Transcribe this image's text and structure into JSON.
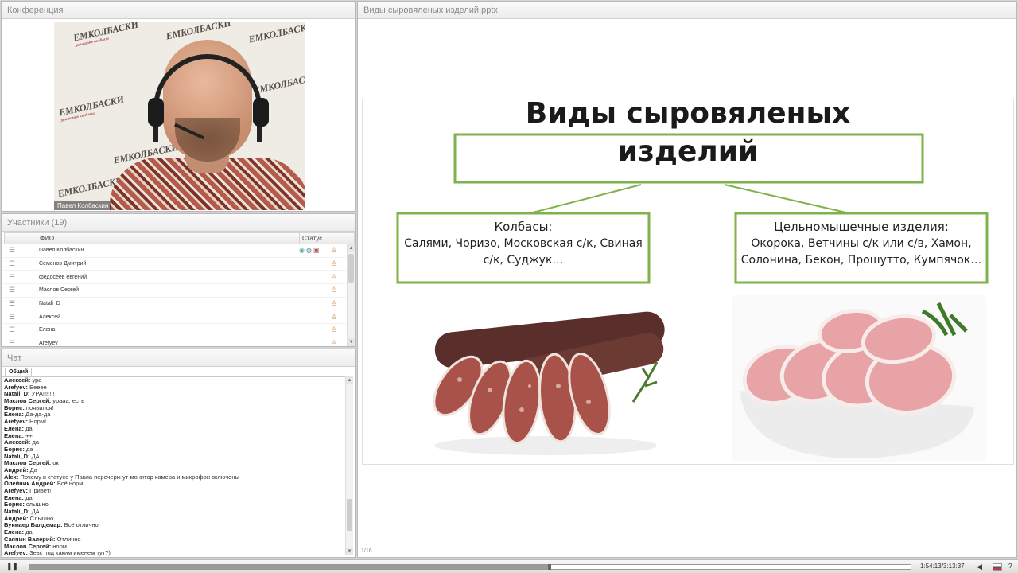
{
  "conference": {
    "title": "Конференция",
    "speaker_name": "Павел Колбаскин",
    "logo_text": "ЕМКОЛБАСКИ",
    "logo_sub": "домашние колбасы"
  },
  "participants": {
    "title": "Участники (19)",
    "col_fio": "ФИО",
    "col_status": "Статус",
    "rows": [
      {
        "name": "Павел Колбаскин",
        "presenter": true
      },
      {
        "name": "Семенов Дмитрий"
      },
      {
        "name": "федосеев евгений"
      },
      {
        "name": "Маслов Сергей"
      },
      {
        "name": "Natali_D"
      },
      {
        "name": "Алексей"
      },
      {
        "name": "Елена"
      },
      {
        "name": "Arefyev"
      }
    ]
  },
  "chat": {
    "title": "Чат",
    "tab": "Общий",
    "messages": [
      {
        "author": "Алексей:",
        "text": " ура"
      },
      {
        "author": "Arefyev:",
        "text": " Еееее"
      },
      {
        "author": "Natali_D:",
        "text": " УРА!!!!!!!"
      },
      {
        "author": "Маслов Сергей:",
        "text": " урааа, есть"
      },
      {
        "author": "Борис:",
        "text": " появился!"
      },
      {
        "author": "Елена:",
        "text": " Да-да-да"
      },
      {
        "author": "Arefyev:",
        "text": " Норм!"
      },
      {
        "author": "Елена:",
        "text": " да"
      },
      {
        "author": "Елена:",
        "text": " ++"
      },
      {
        "author": "Алексей:",
        "text": " да"
      },
      {
        "author": "Борис:",
        "text": " да"
      },
      {
        "author": "Natali_D:",
        "text": " ДА"
      },
      {
        "author": "Маслов Сергей:",
        "text": " ок"
      },
      {
        "author": "Андрей:",
        "text": " Да"
      },
      {
        "author": "Alex:",
        "text": " Почему в статусе у Павла перечеркнут монитор камера и микрофон включены"
      },
      {
        "author": "Олейник Андрей:",
        "text": " Всё норм"
      },
      {
        "author": "Arefyev:",
        "text": " Привет!"
      },
      {
        "author": "Елена:",
        "text": " да"
      },
      {
        "author": "Борис:",
        "text": " слышно"
      },
      {
        "author": "Natali_D:",
        "text": " ДА"
      },
      {
        "author": "Андрей:",
        "text": " Слышно"
      },
      {
        "author": "Букмаер Валдемар:",
        "text": " Всё отлично"
      },
      {
        "author": "Елена:",
        "text": " да"
      },
      {
        "author": "Саяпин Валерий:",
        "text": " Отлично"
      },
      {
        "author": "Маслов Сергей:",
        "text": " норм"
      },
      {
        "author": "Arefyev:",
        "text": " Зевс под каким именем тут?)"
      }
    ]
  },
  "presentation": {
    "title": "Виды сыровяленых изделий.pptx",
    "slide_title_line1": "Виды сыровяленых",
    "slide_title_line2": "изделий",
    "left_box_head": "Колбасы:",
    "left_box_line1": "Салями, Чоризо, Московская с/к, Свиная",
    "left_box_line2": "с/к, Суджук…",
    "right_box_head": "Цельномышечные изделия:",
    "right_box_line1": "Окорока, Ветчины с/к или с/в, Хамон,",
    "right_box_line2": "Солонина, Бекон, Прошутто, Кумпячок…",
    "page": "1/16",
    "accent": "#7fb24a"
  },
  "player": {
    "time": "1:54:13/3:13:37",
    "progress": 0.59,
    "play_icon": "pause-icon",
    "language_icon": "russian-flag-icon",
    "help": "?"
  }
}
